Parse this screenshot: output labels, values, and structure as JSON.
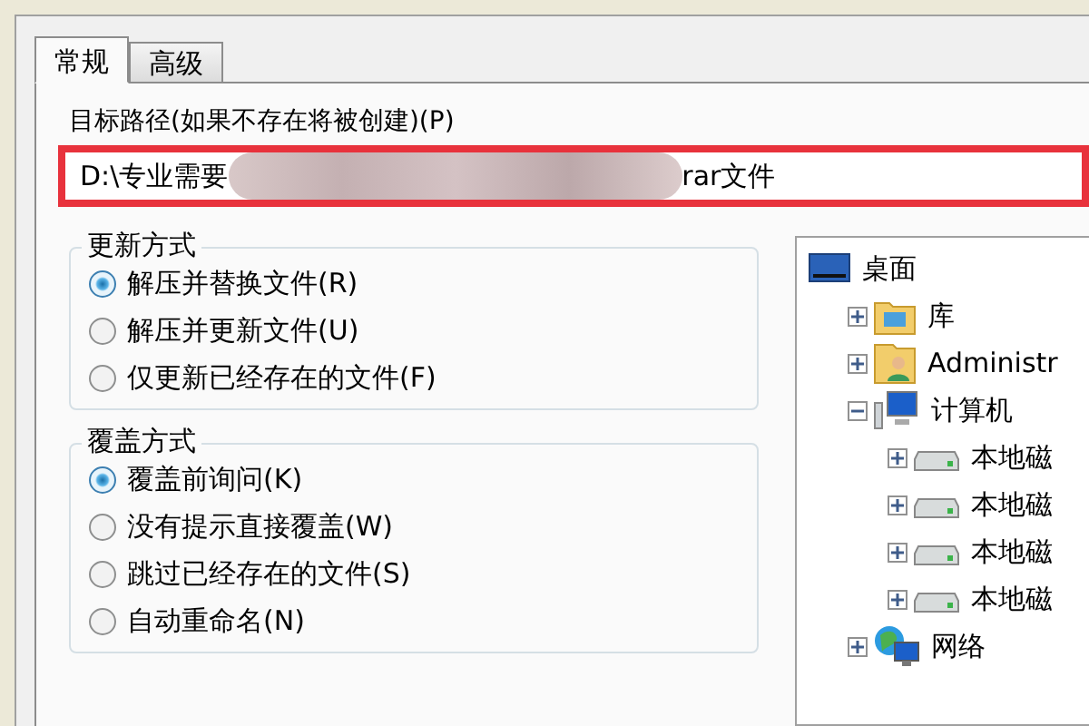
{
  "tabs": [
    {
      "label": "常规",
      "selected": true
    },
    {
      "label": "高级",
      "selected": false
    }
  ],
  "path": {
    "label": "目标路径(如果不存在将被创建)(P)",
    "value_start": "D:\\专业需要",
    "value_end": "rar文件",
    "highlighted": true
  },
  "groups": [
    {
      "title": "更新方式",
      "options": [
        {
          "label": "解压并替换文件(R)",
          "selected": true
        },
        {
          "label": "解压并更新文件(U)",
          "selected": false
        },
        {
          "label": "仅更新已经存在的文件(F)",
          "selected": false
        }
      ]
    },
    {
      "title": "覆盖方式",
      "options": [
        {
          "label": "覆盖前询问(K)",
          "selected": true
        },
        {
          "label": "没有提示直接覆盖(W)",
          "selected": false
        },
        {
          "label": "跳过已经存在的文件(S)",
          "selected": false
        },
        {
          "label": "自动重命名(N)",
          "selected": false
        }
      ]
    }
  ],
  "tree": [
    {
      "label": "桌面",
      "kind": "desktop",
      "children": [
        {
          "label": "库",
          "kind": "library",
          "expanded": false
        },
        {
          "label": "Administr",
          "kind": "user",
          "expanded": false
        },
        {
          "label": "计算机",
          "kind": "computer",
          "expanded": true,
          "children": [
            {
              "label": "本地磁",
              "kind": "drive",
              "expanded": false
            },
            {
              "label": "本地磁",
              "kind": "drive",
              "expanded": false
            },
            {
              "label": "本地磁",
              "kind": "drive",
              "expanded": false
            },
            {
              "label": "本地磁",
              "kind": "drive",
              "expanded": false
            }
          ]
        },
        {
          "label": "网络",
          "kind": "network",
          "expanded": false
        }
      ]
    }
  ]
}
